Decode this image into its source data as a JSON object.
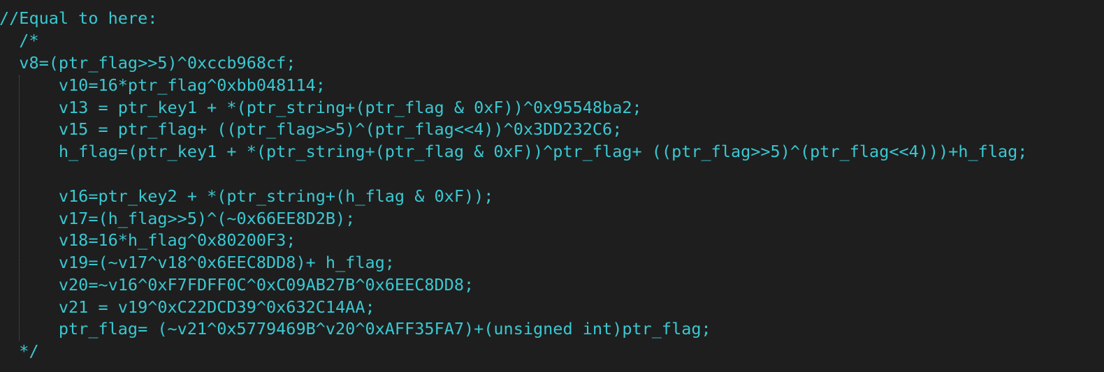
{
  "editor": {
    "lines": [
      "//Equal to here:",
      "  /*",
      "  v8=(ptr_flag>>5)^0xccb968cf;",
      "      v10=16*ptr_flag^0xbb048114;",
      "      v13 = ptr_key1 + *(ptr_string+(ptr_flag & 0xF))^0x95548ba2;",
      "      v15 = ptr_flag+ ((ptr_flag>>5)^(ptr_flag<<4))^0x3DD232C6;",
      "      h_flag=(ptr_key1 + *(ptr_string+(ptr_flag & 0xF))^ptr_flag+ ((ptr_flag>>5)^(ptr_flag<<4)))+h_flag;",
      "",
      "      v16=ptr_key2 + *(ptr_string+(h_flag & 0xF));",
      "      v17=(h_flag>>5)^(~0x66EE8D2B);",
      "      v18=16*h_flag^0x80200F3;",
      "      v19=(~v17^v18^0x6EEC8DD8)+ h_flag;",
      "      v20=~v16^0xF7FDFF0C^0xC09AB27B^0x6EEC8DD8;",
      "      v21 = v19^0xC22DCD39^0x632C14AA;",
      "      ptr_flag= (~v21^0x5779469B^v20^0xAFF35FA7)+(unsigned int)ptr_flag;",
      "  */"
    ],
    "colors": {
      "background": "#1e1e1e",
      "text": "#3ac8d2",
      "indent_guide": "#5a5a5a"
    }
  }
}
